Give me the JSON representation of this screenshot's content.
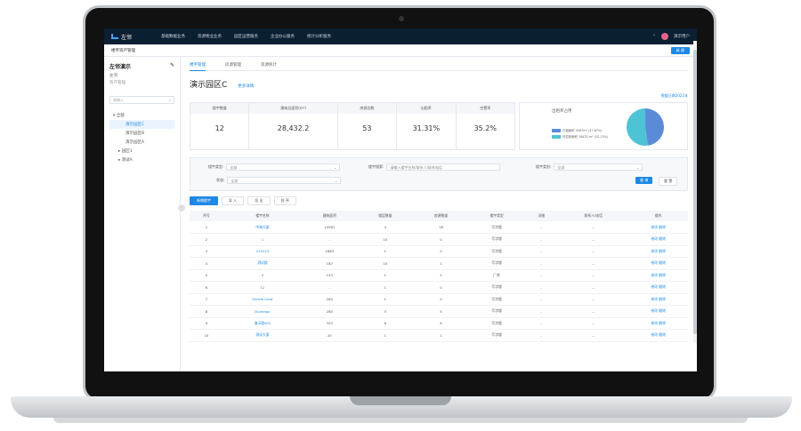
{
  "nav": {
    "logo": "左邻",
    "items": [
      "基础数据业务",
      "资源物业业务",
      "园区运营服务",
      "企业办公服务",
      "统计分析服务"
    ],
    "user": "演示用户"
  },
  "subheader": {
    "title": "楼宇资产管理",
    "action": "新 建"
  },
  "sidebar": {
    "title": "左邻演示",
    "subtitle": "左邻",
    "subtitle2": "资产管理",
    "search_placeholder": "请输入",
    "tree": {
      "root": "全部",
      "children": [
        "演示园区C",
        "演示园区B",
        "演示园区A"
      ],
      "groups": [
        "园区1",
        "测试A"
      ]
    }
  },
  "main": {
    "tabs": [
      "楼宇管理",
      "房源管理",
      "资源统计"
    ],
    "park_title": "演示园区C",
    "more_link": "更多详情",
    "stat_date": "数据日期2021年",
    "stats": [
      {
        "label": "楼宇数量",
        "value": "12"
      },
      {
        "label": "建筑总面积(m²)",
        "value": "28,432.2"
      },
      {
        "label": "房源总数",
        "value": "53"
      },
      {
        "label": "出租率",
        "value": "31.31%"
      },
      {
        "label": "空置率",
        "value": "35.2%"
      }
    ],
    "rate_card": {
      "title": "出租率占用",
      "legend": [
        {
          "label": "已租面积 3587m² (47.87%)",
          "color": "#5b8bd8"
        },
        {
          "label": "可招商面积 18432 m² (52.13%)",
          "color": "#4fc3d6"
        }
      ]
    },
    "filters": {
      "building_type_label": "楼宇类型:",
      "building_type_value": "全部",
      "keyword_label": "楼宇搜索:",
      "keyword_placeholder": "请输入楼宇名称/联系人/联系电话",
      "category_label": "楼宇类别:",
      "category_value": "全部",
      "status_label": "状态:",
      "status_value": "全部",
      "query": "查 询",
      "reset": "重 置"
    },
    "actions": [
      "新增楼宇",
      "导 入",
      "导 出",
      "排 序"
    ],
    "table": {
      "headers": [
        "序号",
        "楼宇名称",
        "建筑面积",
        "楼层数量",
        "房源数量",
        "楼宇类型",
        "详细",
        "联系人/电话",
        "操作"
      ],
      "rows": [
        [
          "1",
          "中海大厦",
          "10561",
          "4",
          "18",
          "写字楼",
          "-",
          "--",
          "修改 删除"
        ],
        [
          "2",
          "1",
          "-",
          "10",
          "0",
          "写字楼",
          "-",
          "--",
          "修改 删除"
        ],
        [
          "3",
          "123123",
          "1883",
          "1",
          "0",
          "写字楼",
          "-",
          "--",
          "修改 删除"
        ],
        [
          "4",
          "测试楼",
          "187",
          "10",
          "1",
          "写字楼",
          "-",
          "--",
          "修改 删除"
        ],
        [
          "5",
          "3",
          "143",
          "1",
          "2",
          "厂房",
          "-",
          "--",
          "修改 删除"
        ],
        [
          "6",
          "12",
          "-",
          "1",
          "0",
          "写字楼",
          "-",
          "--",
          "修改 删除"
        ],
        [
          "7",
          "Gentle Land",
          "264",
          "1",
          "0",
          "写字楼",
          "-",
          "--",
          "修改 删除"
        ],
        [
          "8",
          "Dunnegu",
          "280",
          "5",
          "5",
          "写字楼",
          "-",
          "--",
          "修改 删除"
        ],
        [
          "9",
          "演示楼001",
          "320",
          "6",
          "6",
          "写字楼",
          "-",
          "--",
          "修改 删除"
        ],
        [
          "10",
          "测试大厦",
          "20",
          "1",
          "1",
          "写字楼",
          "-",
          "--",
          "修改 删除"
        ]
      ]
    }
  },
  "chart_data": {
    "type": "pie",
    "title": "出租率占用",
    "categories": [
      "已租面积",
      "可招商面积"
    ],
    "values": [
      47.87,
      52.13
    ],
    "colors": [
      "#5b8bd8",
      "#4fc3d6"
    ]
  }
}
